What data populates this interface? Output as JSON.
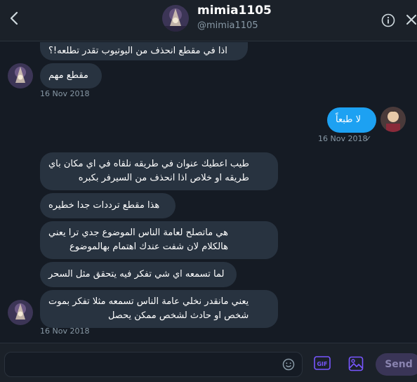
{
  "header": {
    "name": "mimia1105",
    "handle": "@mimia1105"
  },
  "messages": [
    {
      "text": "اذا في مقطع انحذف من اليوتيوب تقدر تطلعه!؟",
      "from": "them"
    },
    {
      "text": "مقطع مهم",
      "from": "them"
    },
    {
      "text": "16 Nov 2018",
      "kind": "timestamp"
    },
    {
      "text": "لا طبعاً",
      "from": "me"
    },
    {
      "text": "16 Nov 2018",
      "kind": "timestamp",
      "status": "✓"
    },
    {
      "text": "طيب اعطيك عنوان في طريقه نلقاه في اي مكان باي\nطريقه او خلاص اذا انحذف من السيرفر بكبره",
      "from": "them"
    },
    {
      "text": "هذا مقطع ترددات جدا خطيره",
      "from": "them"
    },
    {
      "text": "هي ماتصلح لعامة الناس الموضوع جدي ترا يعني\nهالكلام لان شفت عندك اهتمام بهالموضوع",
      "from": "them"
    },
    {
      "text": "لما تسمعه اي شي تفكر فيه يتحقق مثل السحر",
      "from": "them"
    },
    {
      "text": "يعني مانقدر نخلي عامة الناس تسمعه مثلا تفكر بموت\nشخص او حادث لشخص ممكن يحصل",
      "from": "them"
    },
    {
      "text": "16 Nov 2018",
      "kind": "timestamp"
    }
  ],
  "composer": {
    "placeholder": "",
    "send_label": "Send",
    "gif_label": "GIF"
  },
  "colors": {
    "background": "#151b24",
    "bubble_them": "#283340",
    "bubble_me": "#1da1f2",
    "muted_text": "#8899a6",
    "accent_purple": "#7856ff"
  },
  "icons": [
    "back-arrow-icon",
    "info-icon",
    "close-icon",
    "emoji-icon",
    "gif-icon",
    "image-icon"
  ]
}
